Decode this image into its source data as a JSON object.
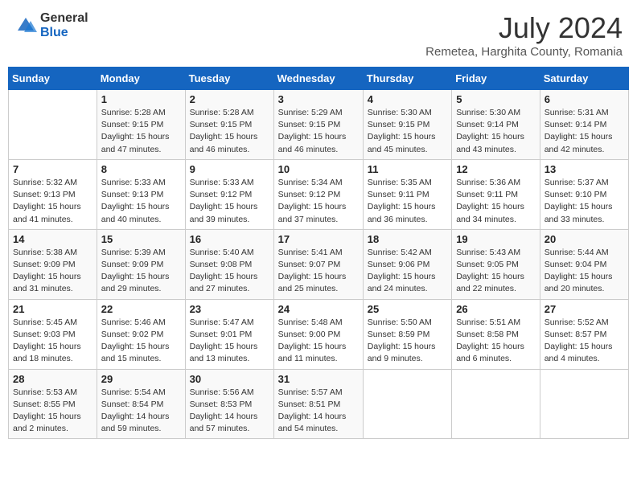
{
  "header": {
    "logo_general": "General",
    "logo_blue": "Blue",
    "month": "July 2024",
    "location": "Remetea, Harghita County, Romania"
  },
  "weekdays": [
    "Sunday",
    "Monday",
    "Tuesday",
    "Wednesday",
    "Thursday",
    "Friday",
    "Saturday"
  ],
  "weeks": [
    [
      {
        "day": "",
        "info": ""
      },
      {
        "day": "1",
        "info": "Sunrise: 5:28 AM\nSunset: 9:15 PM\nDaylight: 15 hours\nand 47 minutes."
      },
      {
        "day": "2",
        "info": "Sunrise: 5:28 AM\nSunset: 9:15 PM\nDaylight: 15 hours\nand 46 minutes."
      },
      {
        "day": "3",
        "info": "Sunrise: 5:29 AM\nSunset: 9:15 PM\nDaylight: 15 hours\nand 46 minutes."
      },
      {
        "day": "4",
        "info": "Sunrise: 5:30 AM\nSunset: 9:15 PM\nDaylight: 15 hours\nand 45 minutes."
      },
      {
        "day": "5",
        "info": "Sunrise: 5:30 AM\nSunset: 9:14 PM\nDaylight: 15 hours\nand 43 minutes."
      },
      {
        "day": "6",
        "info": "Sunrise: 5:31 AM\nSunset: 9:14 PM\nDaylight: 15 hours\nand 42 minutes."
      }
    ],
    [
      {
        "day": "7",
        "info": "Sunrise: 5:32 AM\nSunset: 9:13 PM\nDaylight: 15 hours\nand 41 minutes."
      },
      {
        "day": "8",
        "info": "Sunrise: 5:33 AM\nSunset: 9:13 PM\nDaylight: 15 hours\nand 40 minutes."
      },
      {
        "day": "9",
        "info": "Sunrise: 5:33 AM\nSunset: 9:12 PM\nDaylight: 15 hours\nand 39 minutes."
      },
      {
        "day": "10",
        "info": "Sunrise: 5:34 AM\nSunset: 9:12 PM\nDaylight: 15 hours\nand 37 minutes."
      },
      {
        "day": "11",
        "info": "Sunrise: 5:35 AM\nSunset: 9:11 PM\nDaylight: 15 hours\nand 36 minutes."
      },
      {
        "day": "12",
        "info": "Sunrise: 5:36 AM\nSunset: 9:11 PM\nDaylight: 15 hours\nand 34 minutes."
      },
      {
        "day": "13",
        "info": "Sunrise: 5:37 AM\nSunset: 9:10 PM\nDaylight: 15 hours\nand 33 minutes."
      }
    ],
    [
      {
        "day": "14",
        "info": "Sunrise: 5:38 AM\nSunset: 9:09 PM\nDaylight: 15 hours\nand 31 minutes."
      },
      {
        "day": "15",
        "info": "Sunrise: 5:39 AM\nSunset: 9:09 PM\nDaylight: 15 hours\nand 29 minutes."
      },
      {
        "day": "16",
        "info": "Sunrise: 5:40 AM\nSunset: 9:08 PM\nDaylight: 15 hours\nand 27 minutes."
      },
      {
        "day": "17",
        "info": "Sunrise: 5:41 AM\nSunset: 9:07 PM\nDaylight: 15 hours\nand 25 minutes."
      },
      {
        "day": "18",
        "info": "Sunrise: 5:42 AM\nSunset: 9:06 PM\nDaylight: 15 hours\nand 24 minutes."
      },
      {
        "day": "19",
        "info": "Sunrise: 5:43 AM\nSunset: 9:05 PM\nDaylight: 15 hours\nand 22 minutes."
      },
      {
        "day": "20",
        "info": "Sunrise: 5:44 AM\nSunset: 9:04 PM\nDaylight: 15 hours\nand 20 minutes."
      }
    ],
    [
      {
        "day": "21",
        "info": "Sunrise: 5:45 AM\nSunset: 9:03 PM\nDaylight: 15 hours\nand 18 minutes."
      },
      {
        "day": "22",
        "info": "Sunrise: 5:46 AM\nSunset: 9:02 PM\nDaylight: 15 hours\nand 15 minutes."
      },
      {
        "day": "23",
        "info": "Sunrise: 5:47 AM\nSunset: 9:01 PM\nDaylight: 15 hours\nand 13 minutes."
      },
      {
        "day": "24",
        "info": "Sunrise: 5:48 AM\nSunset: 9:00 PM\nDaylight: 15 hours\nand 11 minutes."
      },
      {
        "day": "25",
        "info": "Sunrise: 5:50 AM\nSunset: 8:59 PM\nDaylight: 15 hours\nand 9 minutes."
      },
      {
        "day": "26",
        "info": "Sunrise: 5:51 AM\nSunset: 8:58 PM\nDaylight: 15 hours\nand 6 minutes."
      },
      {
        "day": "27",
        "info": "Sunrise: 5:52 AM\nSunset: 8:57 PM\nDaylight: 15 hours\nand 4 minutes."
      }
    ],
    [
      {
        "day": "28",
        "info": "Sunrise: 5:53 AM\nSunset: 8:55 PM\nDaylight: 15 hours\nand 2 minutes."
      },
      {
        "day": "29",
        "info": "Sunrise: 5:54 AM\nSunset: 8:54 PM\nDaylight: 14 hours\nand 59 minutes."
      },
      {
        "day": "30",
        "info": "Sunrise: 5:56 AM\nSunset: 8:53 PM\nDaylight: 14 hours\nand 57 minutes."
      },
      {
        "day": "31",
        "info": "Sunrise: 5:57 AM\nSunset: 8:51 PM\nDaylight: 14 hours\nand 54 minutes."
      },
      {
        "day": "",
        "info": ""
      },
      {
        "day": "",
        "info": ""
      },
      {
        "day": "",
        "info": ""
      }
    ]
  ]
}
